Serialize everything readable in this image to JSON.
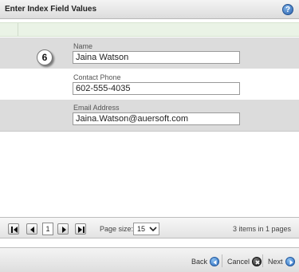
{
  "dialog": {
    "title": "Enter Index Field Values",
    "help_icon": "?"
  },
  "step_badge": "6",
  "fields": [
    {
      "label": "Name",
      "value": "Jaina Watson"
    },
    {
      "label": "Contact Phone",
      "value": "602-555-4035"
    },
    {
      "label": "Email Address",
      "value": "Jaina.Watson@auersoft.com"
    }
  ],
  "pager": {
    "current_page": "1",
    "page_size_label": "Page size:",
    "page_size_value": "15",
    "items_info": "3 items in 1 pages"
  },
  "footer": {
    "back_label": "Back",
    "cancel_label": "Cancel",
    "next_label": "Next"
  },
  "colors": {
    "header_strip": "#eaf3e6",
    "row_shade": "#dcdcdc",
    "accent_blue": "#2a6cc0"
  }
}
